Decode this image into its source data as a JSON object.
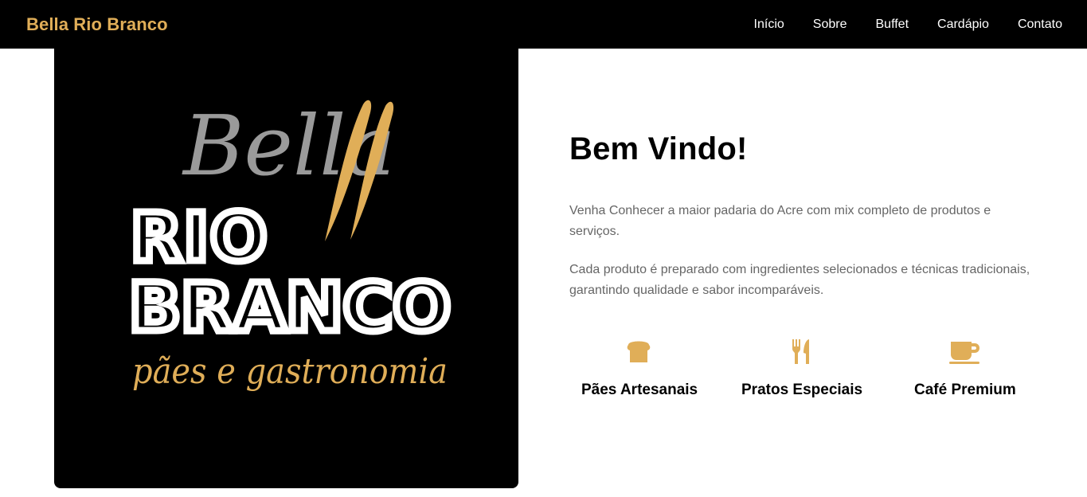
{
  "nav": {
    "brand": "Bella Rio Branco",
    "links": [
      "Início",
      "Sobre",
      "Buffet",
      "Cardápio",
      "Contato"
    ]
  },
  "logo": {
    "script_word": "Bella",
    "line1": "RIO",
    "line2": "BRANCO",
    "tagline": "pães e gastronomia"
  },
  "hero": {
    "title": "Bem Vindo!",
    "paragraphs": [
      "Venha Conhecer a maior padaria do Acre com mix completo de produtos e serviços.",
      "Cada produto é preparado com ingredientes selecionados e técnicas tradicionais, garantindo qualidade e sabor incomparáveis."
    ]
  },
  "features": [
    {
      "icon": "bread-icon",
      "label": "Pães Artesanais"
    },
    {
      "icon": "utensils-icon",
      "label": "Pratos Especiais"
    },
    {
      "icon": "coffee-cup-icon",
      "label": "Café Premium"
    }
  ],
  "colors": {
    "accent": "#e0ae58",
    "nav_background": "#000000",
    "logo_grey": "#9a9a9a",
    "text_muted": "#666666"
  }
}
